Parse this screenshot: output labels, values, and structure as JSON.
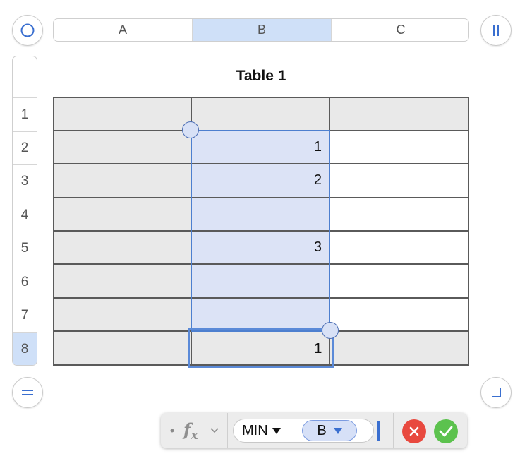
{
  "columns": [
    {
      "label": "A",
      "selected": false
    },
    {
      "label": "B",
      "selected": true
    },
    {
      "label": "C",
      "selected": false
    }
  ],
  "rows": [
    {
      "label": "1",
      "selected": false
    },
    {
      "label": "2",
      "selected": false
    },
    {
      "label": "3",
      "selected": false
    },
    {
      "label": "4",
      "selected": false
    },
    {
      "label": "5",
      "selected": false
    },
    {
      "label": "6",
      "selected": false
    },
    {
      "label": "7",
      "selected": false
    },
    {
      "label": "8",
      "selected": true
    }
  ],
  "table": {
    "title": "Table 1",
    "cells": [
      [
        "",
        "",
        ""
      ],
      [
        "",
        "1",
        ""
      ],
      [
        "",
        "2",
        ""
      ],
      [
        "",
        "",
        ""
      ],
      [
        "",
        "3",
        ""
      ],
      [
        "",
        "",
        ""
      ],
      [
        "",
        "",
        ""
      ],
      [
        "",
        "1",
        ""
      ]
    ],
    "header_rows": 1,
    "header_columns": 1,
    "footer_rows": 1,
    "selected_range": "B2:B7",
    "editing_cell": "B8"
  },
  "formula_bar": {
    "function_icon": "fx-icon",
    "function_name": "MIN",
    "argument": "B"
  },
  "colors": {
    "accent": "#3a6fd0",
    "header_fill": "#e9e9e9",
    "selection_fill": "#dce3f6",
    "header_selected": "#cfe0f8",
    "cancel": "#e8493f",
    "accept": "#5cc24e"
  }
}
